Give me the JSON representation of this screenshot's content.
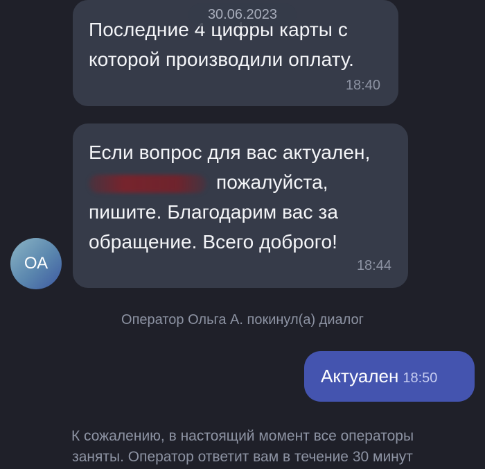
{
  "chat": {
    "date_divider": "30.06.2023",
    "messages": [
      {
        "lines": [
          "Последние 4 цифры карты с",
          "которой производили оплату."
        ],
        "time": "18:40"
      },
      {
        "lines": [
          "Если вопрос для вас актуален,",
          "пожалуйста,",
          "пишите. Благодарим вас за",
          "обращение. Всего доброго!"
        ],
        "time": "18:44"
      }
    ],
    "avatar_initials": "ОА",
    "system_note": "Оператор Ольга А. покинул(а) диалог",
    "user_reply": {
      "text": "Актуален",
      "time": "18:50"
    },
    "footer_note": [
      "К сожалению, в настоящий момент все операторы",
      "заняты. Оператор ответит вам в течение 30 минут"
    ]
  },
  "colors": {
    "background": "#1f2029",
    "incoming_bubble": "#363b49",
    "outgoing_bubble": "#4454af",
    "muted_text": "#8d93a3"
  }
}
